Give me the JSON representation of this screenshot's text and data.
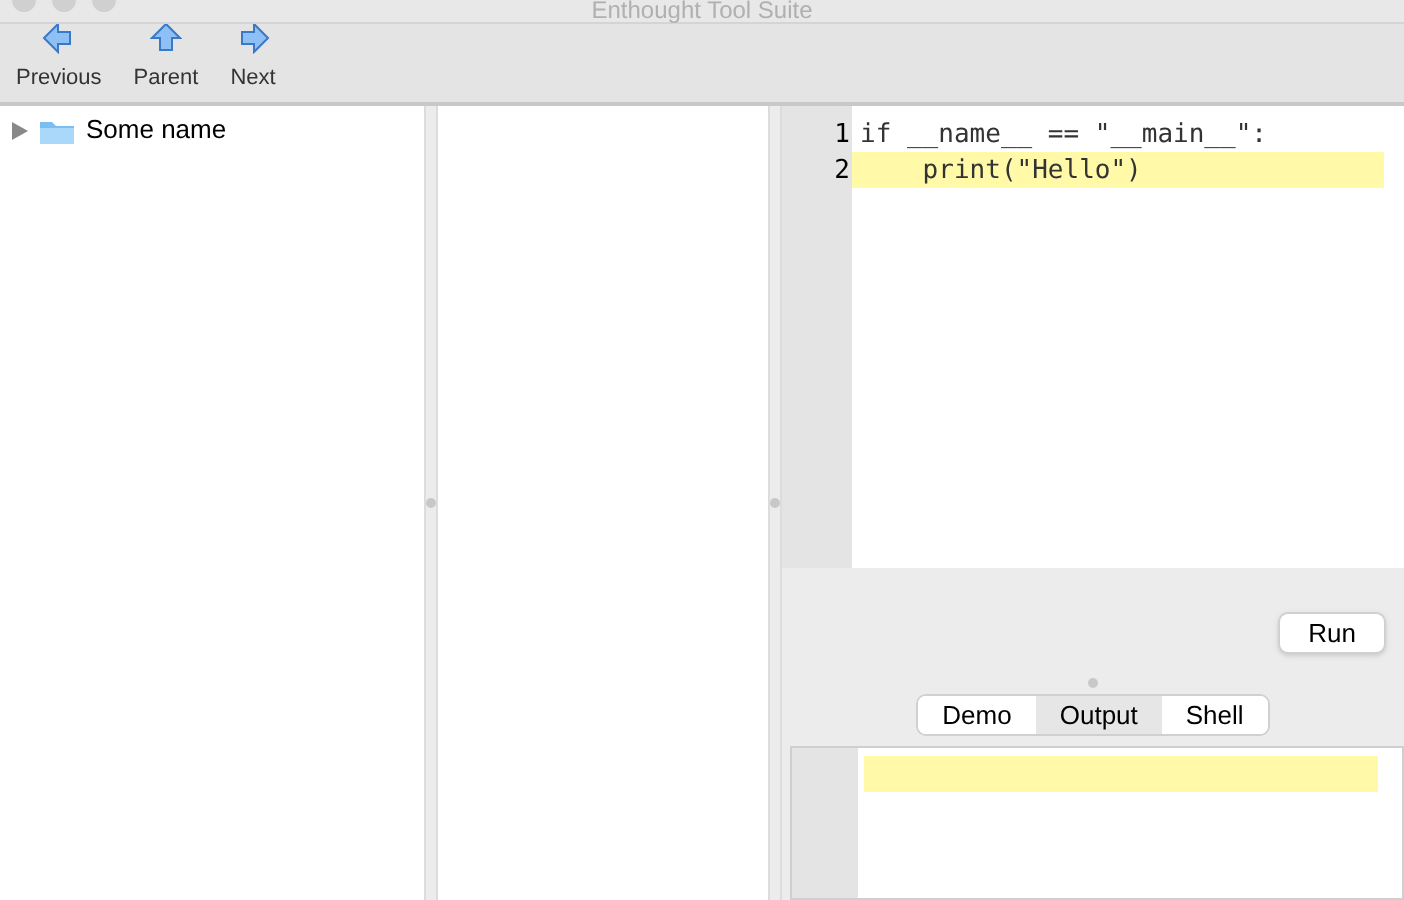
{
  "window": {
    "title": "Enthought Tool Suite"
  },
  "toolbar": [
    {
      "label": "Previous",
      "kind": "left"
    },
    {
      "label": "Parent",
      "kind": "up"
    },
    {
      "label": "Next",
      "kind": "right"
    }
  ],
  "tree": [
    {
      "label": "Some name",
      "expanded": false
    }
  ],
  "editor": {
    "lines": [
      {
        "number": "1",
        "text": "if __name__ == \"__main__\":",
        "highlighted": false
      },
      {
        "number": "2",
        "text": "    print(\"Hello\")",
        "highlighted": true
      }
    ]
  },
  "run_button": "Run",
  "tabs": [
    {
      "label": "Demo",
      "selected": false
    },
    {
      "label": "Output",
      "selected": true
    },
    {
      "label": "Shell",
      "selected": false
    }
  ],
  "output": {
    "lines": [
      {
        "highlighted": true
      }
    ]
  }
}
